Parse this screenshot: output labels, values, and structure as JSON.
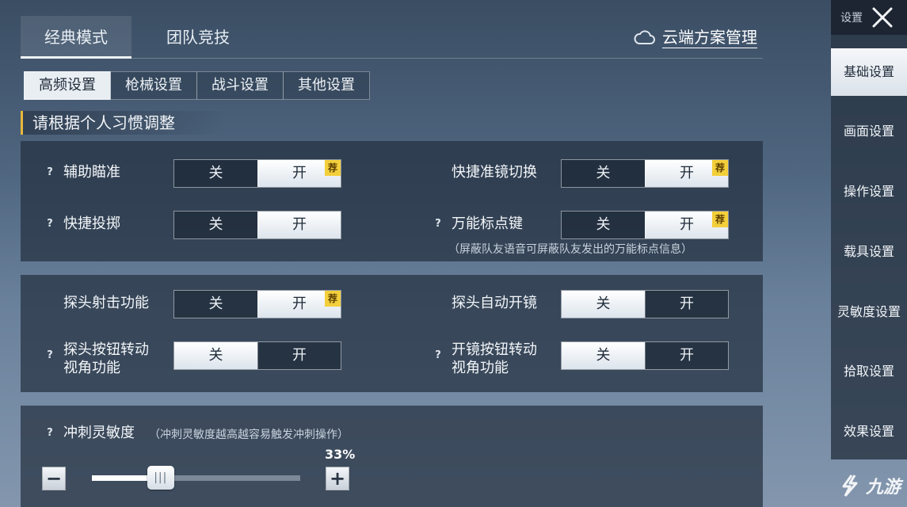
{
  "main_tabs": [
    {
      "label": "经典模式",
      "active": true
    },
    {
      "label": "团队竞技",
      "active": false
    }
  ],
  "cloud": {
    "label": "云端方案管理",
    "icon": "cloud-icon"
  },
  "sub_tabs": [
    {
      "label": "高频设置",
      "active": true
    },
    {
      "label": "枪械设置",
      "active": false
    },
    {
      "label": "战斗设置",
      "active": false
    },
    {
      "label": "其他设置",
      "active": false
    }
  ],
  "section_title": "请根据个人习惯调整",
  "toggle_text": {
    "off": "关",
    "on": "开",
    "recommend": "荐"
  },
  "help_glyph": "?",
  "settings": {
    "aim_assist": {
      "label": "辅助瞄准",
      "value": "on",
      "recommended": true,
      "help": true
    },
    "quick_scope_switch": {
      "label": "快捷准镜切换",
      "value": "on",
      "recommended": true,
      "help": false
    },
    "quick_throw": {
      "label": "快捷投掷",
      "value": "on",
      "recommended": false,
      "help": true
    },
    "universal_marker": {
      "label": "万能标点键",
      "value": "on",
      "recommended": true,
      "help": true,
      "note": "（屏蔽队友语音可屏蔽队友发出的万能标点信息）"
    },
    "peek_fire": {
      "label": "探头射击功能",
      "value": "on",
      "recommended": true,
      "help": false
    },
    "peek_auto_scope": {
      "label": "探头自动开镜",
      "value": "off",
      "recommended": false,
      "help": false
    },
    "peek_button_rotate": {
      "label_line1": "探头按钮转动",
      "label_line2": "视角功能",
      "value": "off",
      "recommended": false,
      "help": true
    },
    "scope_button_rotate": {
      "label_line1": "开镜按钮转动",
      "label_line2": "视角功能",
      "value": "off",
      "recommended": false,
      "help": true
    }
  },
  "sprint": {
    "label": "冲刺灵敏度",
    "note": "（冲刺灵敏度越高越容易触发冲刺操作）",
    "percent_label": "33%",
    "value": 0.33,
    "minus": "−",
    "plus": "+",
    "thumb_grip": "|||"
  },
  "sidebar": {
    "header_label": "设置",
    "items": [
      {
        "label": "基础设置",
        "active": true
      },
      {
        "label": "画面设置",
        "active": false
      },
      {
        "label": "操作设置",
        "active": false
      },
      {
        "label": "载具设置",
        "active": false
      },
      {
        "label": "灵敏度设置",
        "active": false
      },
      {
        "label": "拾取设置",
        "active": false
      },
      {
        "label": "效果设置",
        "active": false
      }
    ]
  },
  "watermark": {
    "text": "九游",
    "icon": "jiuyou-logo-icon"
  },
  "colors": {
    "accent": "#e8b83a",
    "badge": "#f3cf3b",
    "active_bg": "#e9eef3"
  }
}
